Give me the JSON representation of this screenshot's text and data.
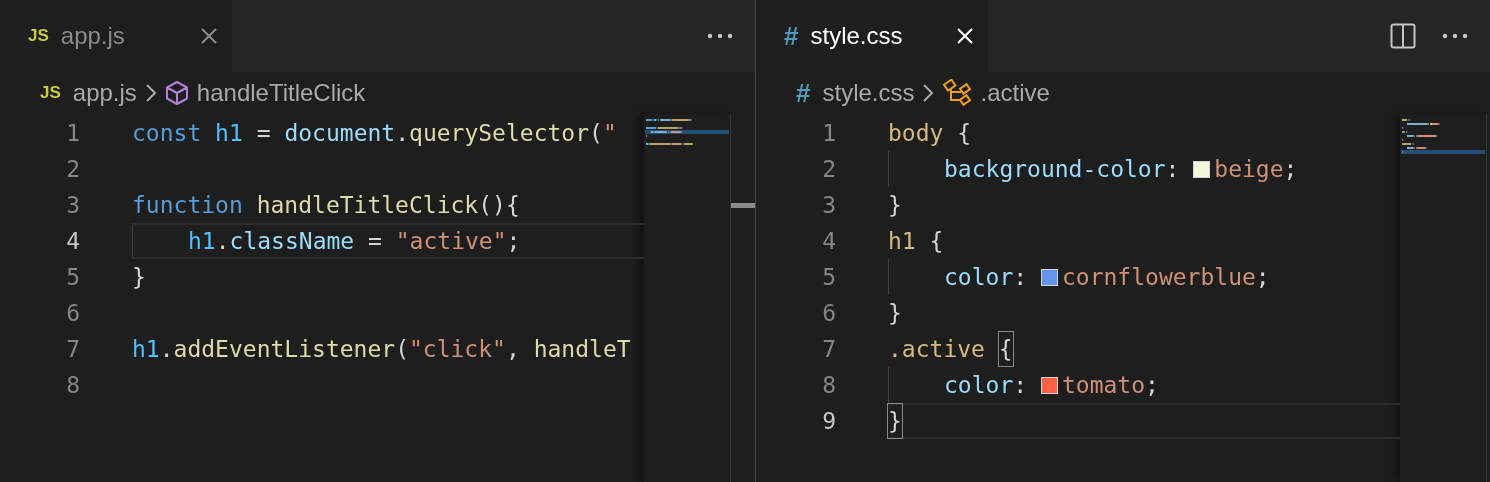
{
  "panes": [
    {
      "focused": false,
      "tabs": [
        {
          "badge": "JS",
          "kind": "js",
          "label": "app.js",
          "selected": true
        }
      ],
      "split_action": false,
      "breadcrumb": {
        "file": {
          "badge": "JS",
          "kind": "js",
          "label": "app.js"
        },
        "symbol": {
          "kind": "method",
          "label": "handleTitleClick"
        }
      },
      "lines": [
        {
          "number": "1",
          "current": false,
          "indented": false,
          "tokens": [
            {
              "kind": "keyword",
              "text": "const"
            },
            {
              "kind": "const",
              "text": "h1"
            },
            {
              "kind": "plain",
              "text": "="
            },
            {
              "kind": "var",
              "text": "document"
            },
            {
              "kind": "plain",
              "text": "."
            },
            {
              "kind": "func",
              "text": "querySelector"
            },
            {
              "kind": "plain",
              "text": "("
            },
            {
              "kind": "string",
              "text": "\""
            }
          ]
        },
        {
          "number": "2",
          "current": false,
          "indented": false
        },
        {
          "number": "3",
          "current": false,
          "indented": false,
          "tokens": [
            {
              "kind": "keyword",
              "text": "function"
            },
            {
              "kind": "func",
              "text": "handleTitleClick"
            },
            {
              "kind": "plain",
              "text": "(){"
            }
          ]
        },
        {
          "number": "4",
          "current": true,
          "indented": true,
          "tokens": [
            {
              "kind": "const",
              "text": "h1"
            },
            {
              "kind": "plain",
              "text": "."
            },
            {
              "kind": "var",
              "text": "className"
            },
            {
              "kind": "plain",
              "text": "="
            },
            {
              "kind": "string",
              "text": "\"active\""
            },
            {
              "kind": "plain",
              "text": ";"
            }
          ]
        },
        {
          "number": "5",
          "current": false,
          "indented": false,
          "tokens": [
            {
              "kind": "plain",
              "text": "}"
            }
          ]
        },
        {
          "number": "6",
          "current": false,
          "indented": false
        },
        {
          "number": "7",
          "current": false,
          "indented": false,
          "tokens": [
            {
              "kind": "const",
              "text": "h1"
            },
            {
              "kind": "plain",
              "text": "."
            },
            {
              "kind": "func",
              "text": "addEventListener"
            },
            {
              "kind": "plain",
              "text": "("
            },
            {
              "kind": "string",
              "text": "\"click\""
            },
            {
              "kind": "plain",
              "text": ","
            },
            {
              "kind": "func",
              "text": "handleT"
            }
          ]
        },
        {
          "number": "8",
          "current": false,
          "indented": false
        }
      ]
    },
    {
      "focused": true,
      "tabs": [
        {
          "badge": "#",
          "kind": "css",
          "label": "style.css",
          "selected": true
        }
      ],
      "split_action": true,
      "breadcrumb": {
        "file": {
          "badge": "#",
          "kind": "css",
          "label": "style.css"
        },
        "symbol": {
          "kind": "selector",
          "label": ".active"
        }
      },
      "lines": [
        {
          "number": "1",
          "current": false,
          "indented": false,
          "tokens": [
            {
              "kind": "selector",
              "text": "body"
            },
            {
              "kind": "plain",
              "text": "{"
            }
          ]
        },
        {
          "number": "2",
          "current": false,
          "indented": true,
          "tokens": [
            {
              "kind": "prop",
              "text": "background-color"
            },
            {
              "kind": "plain",
              "text": ":"
            },
            {
              "kind": "swatch",
              "color": "#f5f5dc"
            },
            {
              "kind": "string",
              "text": "beige"
            },
            {
              "kind": "plain",
              "text": ";"
            }
          ]
        },
        {
          "number": "3",
          "current": false,
          "indented": false,
          "tokens": [
            {
              "kind": "plain",
              "text": "}"
            }
          ]
        },
        {
          "number": "4",
          "current": false,
          "indented": false,
          "tokens": [
            {
              "kind": "selector",
              "text": "h1"
            },
            {
              "kind": "plain",
              "text": "{"
            }
          ]
        },
        {
          "number": "5",
          "current": false,
          "indented": true,
          "tokens": [
            {
              "kind": "prop",
              "text": "color"
            },
            {
              "kind": "plain",
              "text": ":"
            },
            {
              "kind": "swatch",
              "color": "#6495ed"
            },
            {
              "kind": "string",
              "text": "cornflowerblue"
            },
            {
              "kind": "plain",
              "text": ";"
            }
          ]
        },
        {
          "number": "6",
          "current": false,
          "indented": false,
          "tokens": [
            {
              "kind": "plain",
              "text": "}"
            }
          ]
        },
        {
          "number": "7",
          "current": false,
          "indented": false,
          "tokens": [
            {
              "kind": "selector",
              "text": ".active"
            },
            {
              "kind": "bracket",
              "text": "{",
              "matched": true
            }
          ]
        },
        {
          "number": "8",
          "current": false,
          "indented": true,
          "tokens": [
            {
              "kind": "prop",
              "text": "color"
            },
            {
              "kind": "plain",
              "text": ":"
            },
            {
              "kind": "swatch",
              "color": "#ff6347"
            },
            {
              "kind": "string",
              "text": "tomato"
            },
            {
              "kind": "plain",
              "text": ";"
            }
          ]
        },
        {
          "number": "9",
          "current": true,
          "indented": false,
          "tokens": [
            {
              "kind": "bracket",
              "text": "}",
              "matched": true
            }
          ]
        }
      ]
    }
  ]
}
